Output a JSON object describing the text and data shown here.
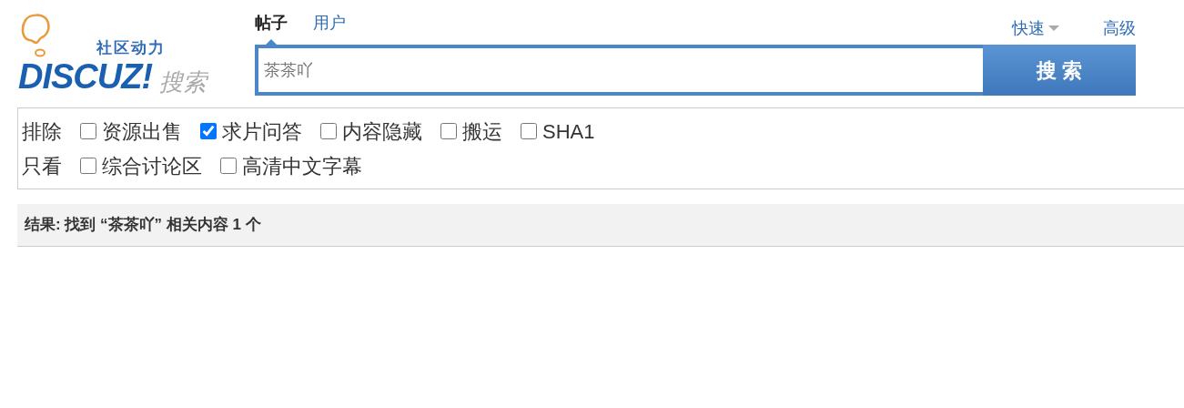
{
  "logo": {
    "tagline": "社区动力",
    "brand": "DISCUZ!",
    "suffix": "搜索"
  },
  "tabs": [
    {
      "label": "帖子",
      "selected": true
    },
    {
      "label": "用户",
      "selected": false
    }
  ],
  "links": [
    {
      "label": "快速",
      "kind": "dropdown"
    },
    {
      "label": "高级",
      "kind": "link"
    }
  ],
  "search": {
    "value": "茶茶吖",
    "button": "搜 索"
  },
  "filters": [
    {
      "label": "排除",
      "options": [
        {
          "label": "资源出售",
          "checked": false
        },
        {
          "label": "求片问答",
          "checked": true
        },
        {
          "label": "内容隐藏",
          "checked": false
        },
        {
          "label": "搬运",
          "checked": false
        },
        {
          "label": "SHA1",
          "checked": false
        }
      ]
    },
    {
      "label": "只看",
      "options": [
        {
          "label": "综合讨论区",
          "checked": false
        },
        {
          "label": "高清中文字幕",
          "checked": false
        }
      ]
    }
  ],
  "result": "结果: 找到 “茶茶吖” 相关内容 1 个"
}
